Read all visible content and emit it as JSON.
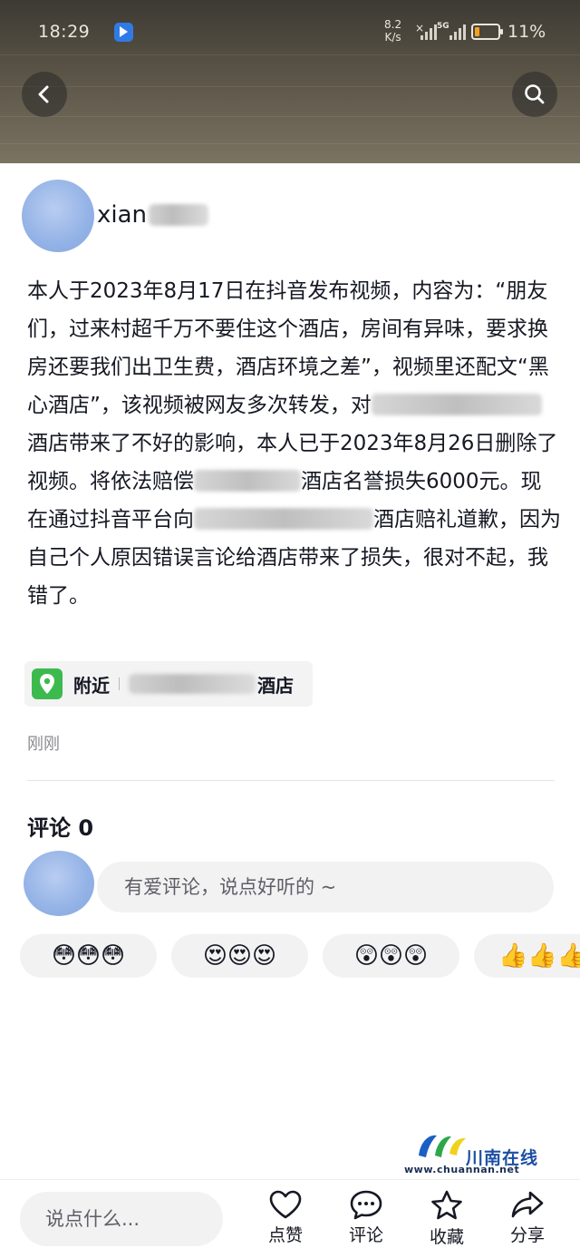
{
  "status_bar": {
    "time": "18:29",
    "net_speed_value": "8.2",
    "net_speed_unit": "K/s",
    "network": "5G",
    "battery_percent": "11%",
    "battery_level": 0.11
  },
  "header": {
    "back_icon": "chevron-left-icon",
    "search_icon": "search-icon"
  },
  "author": {
    "name": "xian"
  },
  "post": {
    "seg1": "本人于2023年8月17日在抖音发布视频，内容为：“朋友们，过来村超千万不要住这个酒店，房间有异味，要求换房还要我们出卫生费，酒店环境之差”，视频里还配文“黑心酒店”，该视频被网友多次转发，对",
    "seg2": "酒店带来了不好的影响，本人已于2023年8月26日删除了视频。将依法赔偿",
    "seg3": "酒店名誉损失6000元。现在通过抖音平台向",
    "seg4": "酒店赔礼道歉，因为自己个人原因错误言论给酒店带来了损失，很对不起，我错了。"
  },
  "location": {
    "icon": "location-pin-icon",
    "nearby_label": "附近",
    "name_suffix": "酒店"
  },
  "time_ago": "刚刚",
  "comments": {
    "title": "评论 0",
    "placeholder": "有爱评论，说点好听的 ~"
  },
  "quick_emojis": [
    "😳😳😳",
    "😍😍😍",
    "😲😲😲",
    "👍👍👍"
  ],
  "watermark": {
    "title": "川南在线",
    "url": "www.chuannan.net"
  },
  "bottom_bar": {
    "input_placeholder": "说点什么...",
    "like_label": "点赞",
    "comment_label": "评论",
    "favorite_label": "收藏",
    "share_label": "分享"
  },
  "colors": {
    "location_icon_bg": "#3dba4e",
    "avatar_blue": "#93b2e6",
    "text_primary": "#161823",
    "text_secondary": "#8a8b91"
  }
}
